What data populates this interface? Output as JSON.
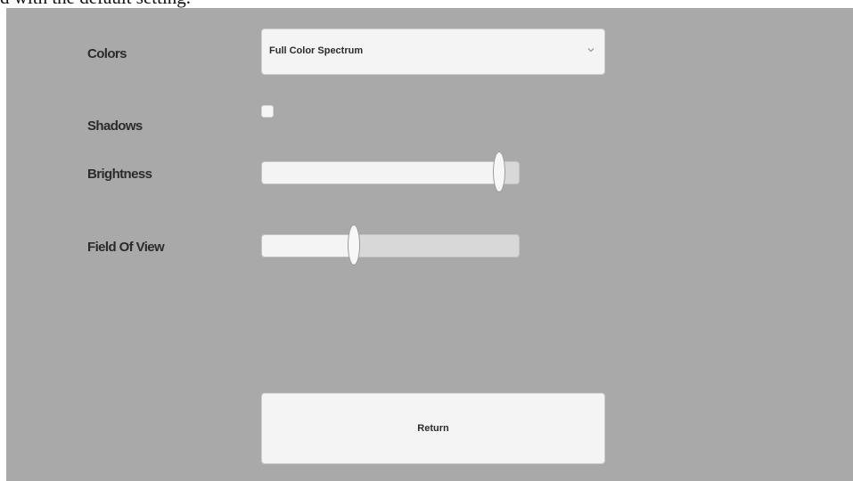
{
  "caption": "d with the default setting.",
  "settings": {
    "colors": {
      "label": "Colors",
      "selected": "Full Color Spectrum"
    },
    "shadows": {
      "label": "Shadows",
      "checked": false
    },
    "brightness": {
      "label": "Brightness",
      "value_fraction": 0.92
    },
    "field_of_view": {
      "label": "Field Of View",
      "value_fraction": 0.36
    }
  },
  "return_button": {
    "label": "Return"
  },
  "icons": {
    "dropdown": "chevron-down-icon"
  },
  "colors": {
    "panel_background": "#a9a9a9",
    "control_background": "#f4f4f4",
    "track_background": "#d8d8d8"
  }
}
